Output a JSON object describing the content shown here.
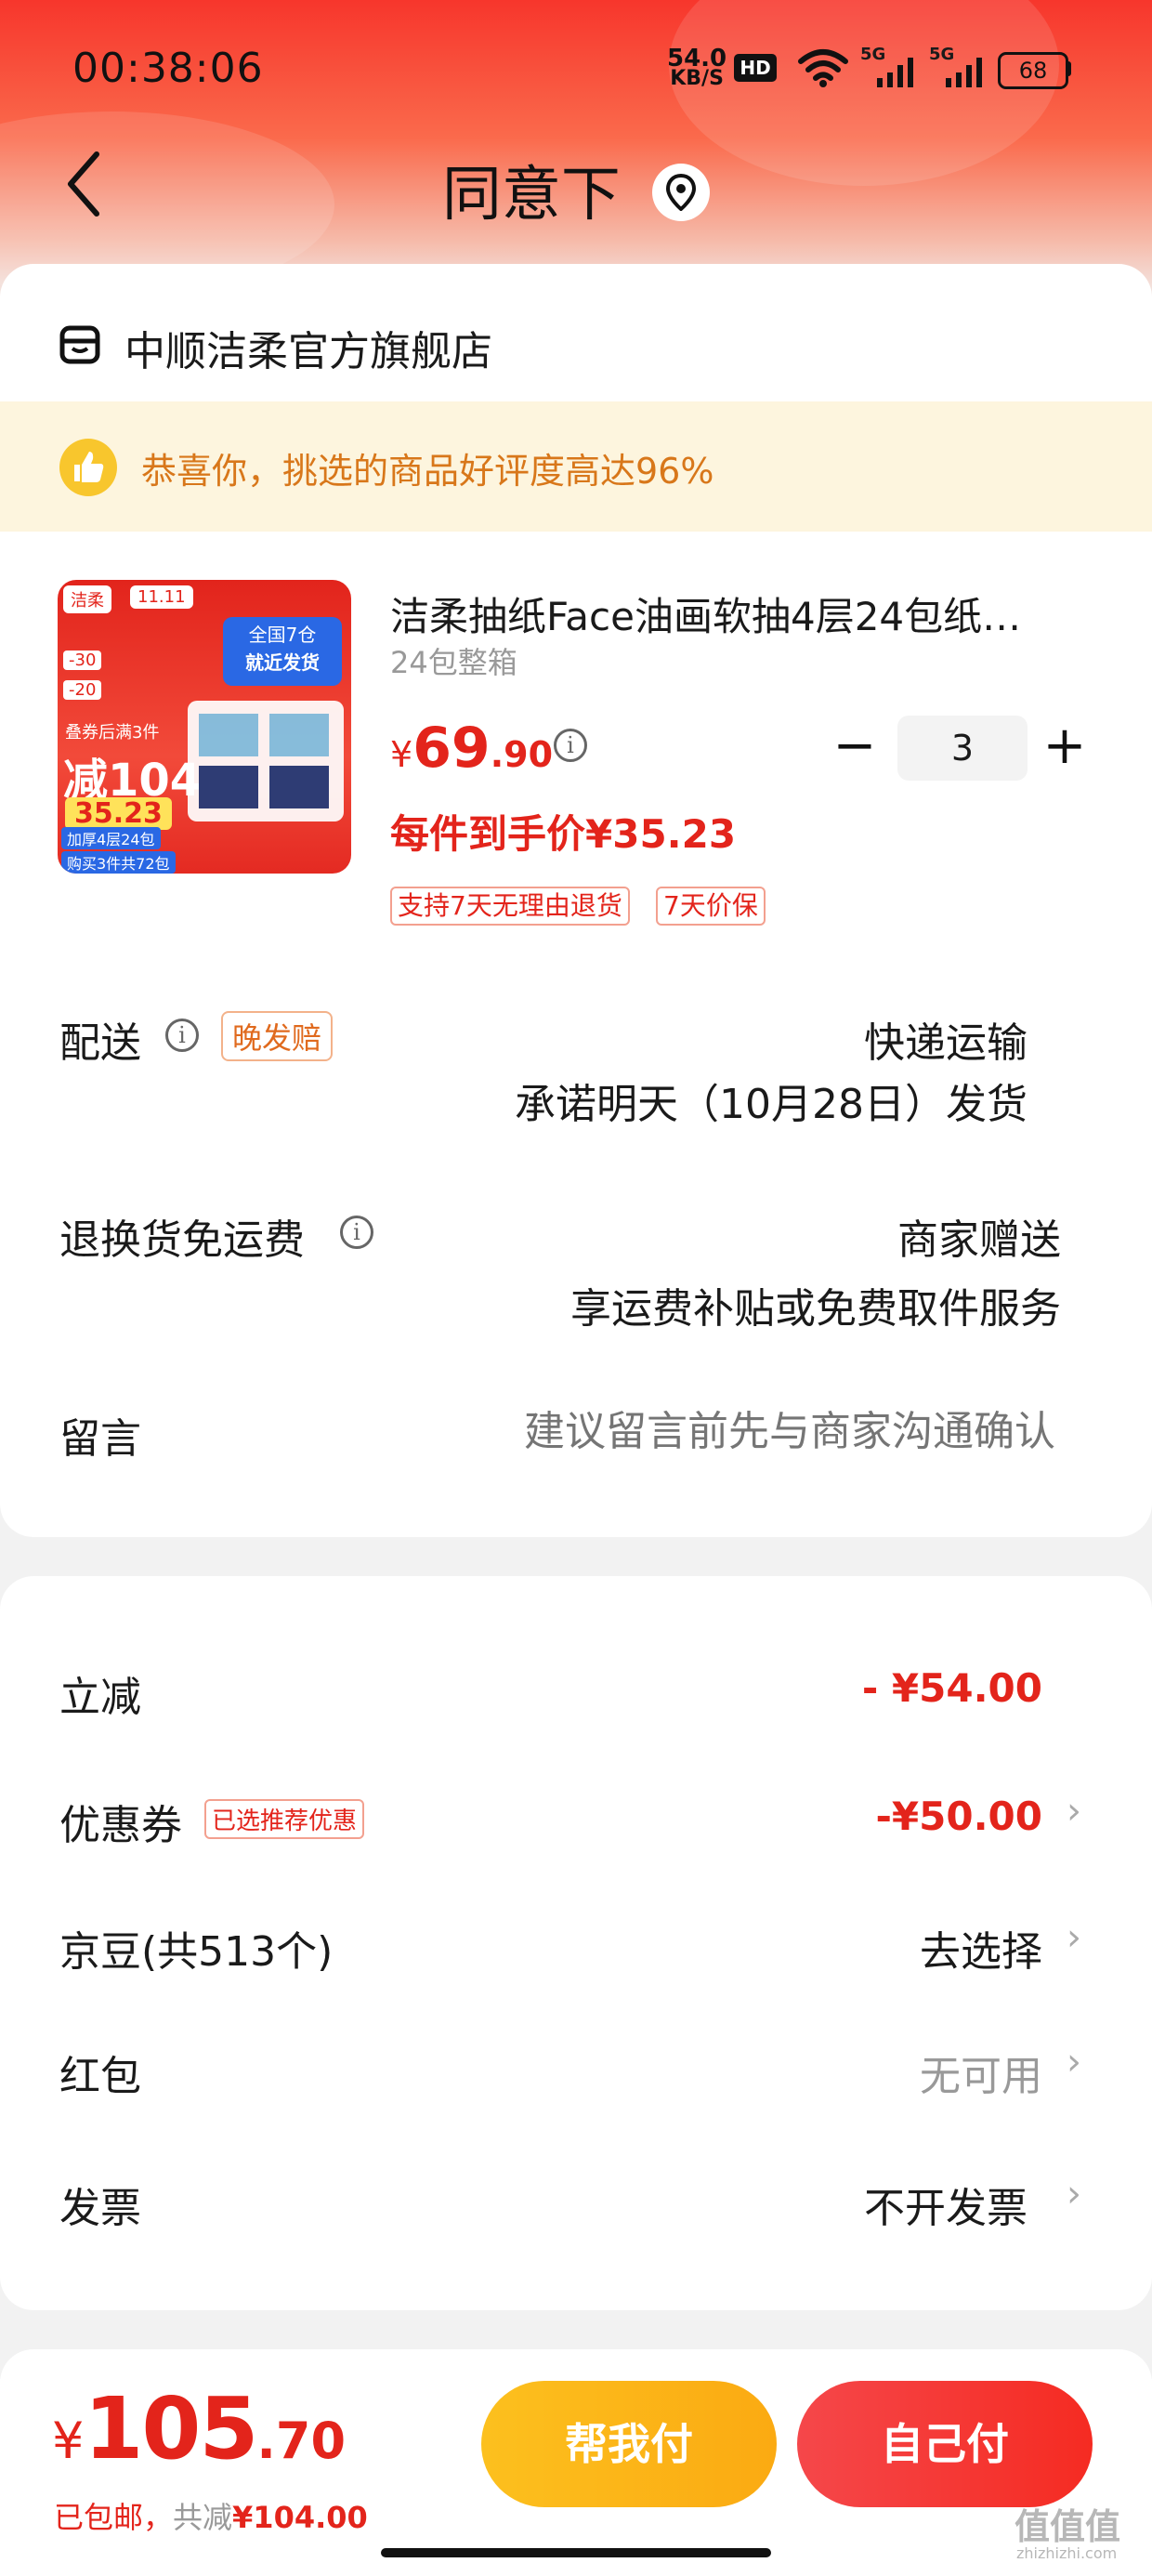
{
  "status_bar": {
    "time": "00:38:06",
    "net_speed": "54.0",
    "net_unit": "KB/S",
    "hd": "HD",
    "sig1": "5G",
    "sig2": "5G",
    "battery": "68"
  },
  "header": {
    "title": "同意下"
  },
  "shop": {
    "name": "中顺洁柔官方旗舰店"
  },
  "banner": {
    "text": "恭喜你，挑选的商品好评度高达96%"
  },
  "product": {
    "title": "洁柔抽纸Face油画软抽4层24包纸…",
    "spec": "24包整箱",
    "currency": "¥",
    "price_int": "69",
    "price_dec": ".90",
    "quantity": "3",
    "unit_price_note": "每件到手价¥35.23",
    "tags": [
      "支持7天无理由退货",
      "7天价保"
    ],
    "thumb": {
      "badge_left": "洁柔",
      "badge_right": "11.11",
      "corner": "全国7仓",
      "corner2": "就近发货",
      "coupon1": "-30",
      "coupon2": "-20",
      "promo": "减104",
      "promo_price": "35.23",
      "limit": "叠券后满3件",
      "foot1": "加厚4层24包",
      "foot2": "购买3件共72包"
    }
  },
  "delivery": {
    "label": "配送",
    "badge": "晚发赔",
    "method": "快递运输",
    "promise": "承诺明天（10月28日）发货"
  },
  "return_shipping": {
    "label": "退换货免运费",
    "value": "商家赠送",
    "detail": "享运费补贴或免费取件服务"
  },
  "message": {
    "label": "留言",
    "placeholder": "建议留言前先与商家沟通确认"
  },
  "discounts": {
    "instant": {
      "label": "立减",
      "value": "- ¥54.00"
    },
    "coupon": {
      "label": "优惠券",
      "badge": "已选推荐优惠",
      "value": "-¥50.00"
    },
    "jd_beans": {
      "label": "京豆(共513个)",
      "value": "去选择"
    },
    "red_packet": {
      "label": "红包",
      "value": "无可用"
    },
    "invoice": {
      "label": "发票",
      "value": "不开发票"
    }
  },
  "footer": {
    "currency": "¥",
    "total_int": "105",
    "total_dec": ".70",
    "note_prefix": "已包邮，",
    "note_saved_label": "共减",
    "note_saved": "¥104.00",
    "help_pay": "帮我付",
    "self_pay": "自己付"
  },
  "watermark": {
    "text": "值值值",
    "url": "zhizhizhi.com"
  },
  "colors": {
    "accent": "#e3241b",
    "help_pay_btn": "#fbb316",
    "self_pay_btn": "#f43b31",
    "banner_bg": "#fdf5de"
  }
}
